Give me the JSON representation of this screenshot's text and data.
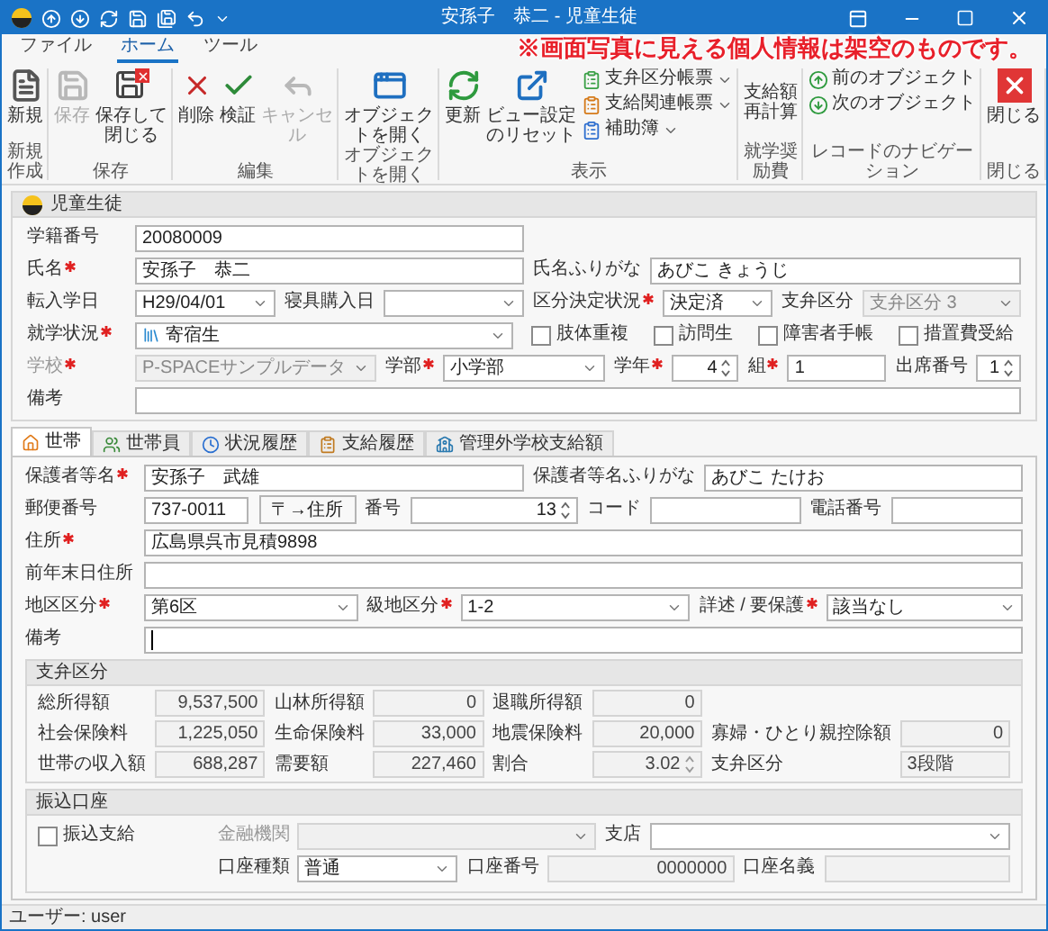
{
  "window": {
    "title": "安孫子　恭二 - 児童生徒"
  },
  "notice": "※画面写真に見える個人情報は架空のものです。",
  "ribbon": {
    "tabs": [
      {
        "label": "ファイル",
        "selected": false
      },
      {
        "label": "ホーム",
        "selected": true
      },
      {
        "label": "ツール",
        "selected": false
      }
    ],
    "groups": [
      {
        "label": "新規作成",
        "items": [
          {
            "kind": "large",
            "label": "新規",
            "disabled": false
          }
        ]
      },
      {
        "label": "保存",
        "items": [
          {
            "kind": "large",
            "label": "保存",
            "disabled": true
          },
          {
            "kind": "large",
            "label": "保存して閉じる",
            "disabled": false
          }
        ]
      },
      {
        "label": "編集",
        "items": [
          {
            "kind": "large",
            "label": "削除",
            "disabled": false
          },
          {
            "kind": "large",
            "label": "検証",
            "disabled": false
          },
          {
            "kind": "large",
            "label": "キャンセル",
            "disabled": true
          }
        ]
      },
      {
        "label": "オブジェクトを開く",
        "items": [
          {
            "kind": "large",
            "label": "オブジェクトを開く",
            "disabled": false
          }
        ]
      },
      {
        "label": "表示",
        "items": [
          {
            "kind": "large",
            "label": "更新",
            "disabled": false
          },
          {
            "kind": "large",
            "label": "ビュー設定のリセット",
            "disabled": false
          },
          {
            "kind": "menu",
            "label": "支弁区分帳票",
            "disabled": false
          },
          {
            "kind": "menu",
            "label": "支給関連帳票",
            "disabled": false
          },
          {
            "kind": "menu",
            "label": "補助簿",
            "disabled": false
          }
        ]
      },
      {
        "label": "就学奨励費",
        "items": [
          {
            "kind": "plain",
            "label": "支給額再計算",
            "disabled": false
          }
        ]
      },
      {
        "label": "レコードのナビゲーション",
        "items": [
          {
            "kind": "small",
            "label": "前のオブジェクト",
            "disabled": false
          },
          {
            "kind": "small",
            "label": "次のオブジェクト",
            "disabled": false
          }
        ]
      },
      {
        "label": "閉じる",
        "items": [
          {
            "kind": "large",
            "label": "閉じる",
            "disabled": false
          }
        ]
      }
    ]
  },
  "student": {
    "title": "児童生徒",
    "rows": [
      [
        {
          "kind": "text",
          "label": "学籍番号",
          "required": false,
          "disabled": false,
          "value": "20080009"
        }
      ],
      [
        {
          "kind": "text",
          "label": "氏名",
          "required": true,
          "disabled": false,
          "value": "安孫子　恭二"
        },
        {
          "kind": "text",
          "label": "氏名ふりがな",
          "required": false,
          "disabled": false,
          "value": "あびこ きょうじ"
        }
      ],
      [
        {
          "kind": "select",
          "label": "転入学日",
          "required": false,
          "disabled": false,
          "value": "H29/04/01"
        },
        {
          "kind": "select",
          "label": "寝具購入日",
          "required": false,
          "disabled": false
        },
        {
          "kind": "select",
          "label": "区分決定状況",
          "required": true,
          "disabled": false,
          "value": "決定済"
        },
        {
          "kind": "select",
          "label": "支弁区分",
          "required": false,
          "disabled": true,
          "value": "支弁区分 3"
        }
      ],
      [
        {
          "kind": "select",
          "label": "就学状況",
          "required": true,
          "disabled": false,
          "value": "寄宿生",
          "has_icon": true
        },
        {
          "kind": "checkbox",
          "label": "肢体重複",
          "checked": false
        },
        {
          "kind": "checkbox",
          "label": "訪問生",
          "checked": false
        },
        {
          "kind": "checkbox",
          "label": "障害者手帳",
          "checked": false
        },
        {
          "kind": "checkbox",
          "label": "措置費受給",
          "checked": false
        }
      ],
      [
        {
          "kind": "select",
          "label": "学校",
          "required": true,
          "disabled": true,
          "value": "P-SPACEサンプルデータ"
        },
        {
          "kind": "select",
          "label": "学部",
          "required": true,
          "disabled": false,
          "value": "小学部"
        },
        {
          "kind": "spin",
          "label": "学年",
          "required": true,
          "disabled": false,
          "value": "4"
        },
        {
          "kind": "text",
          "label": "組",
          "required": true,
          "disabled": false,
          "value": "1"
        },
        {
          "kind": "spin",
          "label": "出席番号",
          "required": false,
          "disabled": false,
          "value": "1"
        }
      ],
      [
        {
          "kind": "text",
          "label": "備考",
          "required": false,
          "disabled": false
        }
      ]
    ]
  },
  "record_tabs": [
    {
      "label": "世帯",
      "selected": true
    },
    {
      "label": "世帯員",
      "selected": false
    },
    {
      "label": "状況履歴",
      "selected": false
    },
    {
      "label": "支給履歴",
      "selected": false
    },
    {
      "label": "管理外学校支給額",
      "selected": false
    }
  ],
  "household": {
    "guardian": [
      {
        "kind": "text",
        "label": "保護者等名",
        "required": true,
        "disabled": false,
        "value": "安孫子　武雄"
      },
      {
        "kind": "text",
        "label": "保護者等名ふりがな",
        "required": false,
        "disabled": false,
        "value": "あびこ たけお"
      }
    ],
    "postal": [
      {
        "kind": "text",
        "label": "郵便番号",
        "required": false,
        "disabled": false,
        "value": "737-0011"
      },
      {
        "kind": "button",
        "value": "〒→住所",
        "disabled": false
      },
      {
        "kind": "spin",
        "label": "番号",
        "required": false,
        "disabled": false,
        "value": "13"
      },
      {
        "kind": "text",
        "label": "コード",
        "required": false,
        "disabled": false
      },
      {
        "kind": "text",
        "label": "電話番号",
        "required": false,
        "disabled": false
      }
    ],
    "address": {
      "kind": "text",
      "label": "住所",
      "required": true,
      "disabled": false,
      "value": "広島県呉市見積9898"
    },
    "previous_address": {
      "kind": "text",
      "label": "前年末日住所",
      "required": false,
      "disabled": false
    },
    "area": [
      {
        "kind": "select",
        "label": "地区区分",
        "required": true,
        "disabled": false,
        "value": "第6区"
      },
      {
        "kind": "select",
        "label": "級地区分",
        "required": true,
        "disabled": false,
        "value": "1-2"
      },
      {
        "kind": "select",
        "label": "詳述 / 要保護",
        "required": true,
        "disabled": false,
        "value": "該当なし"
      }
    ],
    "remarks": {
      "kind": "text",
      "label": "備考",
      "required": false,
      "disabled": false,
      "focused": true
    }
  },
  "support": {
    "title": "支弁区分",
    "rows": [
      [
        {
          "kind": "readonly",
          "label": "総所得額",
          "value": "9,537,500"
        },
        {
          "kind": "readonly",
          "label": "山林所得額",
          "value": "0"
        },
        {
          "kind": "readonly",
          "label": "退職所得額",
          "value": "0"
        }
      ],
      [
        {
          "kind": "readonly",
          "label": "社会保険料",
          "value": "1,225,050"
        },
        {
          "kind": "readonly",
          "label": "生命保険料",
          "value": "33,000"
        },
        {
          "kind": "readonly",
          "label": "地震保険料",
          "value": "20,000"
        },
        {
          "kind": "readonly",
          "label": "寡婦・ひとり親控除額",
          "value": "0"
        }
      ],
      [
        {
          "kind": "readonly",
          "label": "世帯の収入額",
          "value": "688,287"
        },
        {
          "kind": "readonly",
          "label": "需要額",
          "value": "227,460"
        },
        {
          "kind": "readonly_spin",
          "label": "割合",
          "value": "3.02"
        },
        {
          "kind": "readonly_text",
          "label": "支弁区分",
          "value": "3段階"
        }
      ]
    ]
  },
  "transfer": {
    "title": "振込口座",
    "checkbox": {
      "label": "振込支給",
      "checked": false
    },
    "rows": [
      [
        {
          "kind": "select",
          "label": "金融機関",
          "required": false,
          "disabled": true
        },
        {
          "kind": "select",
          "label": "支店",
          "required": false,
          "disabled": false
        }
      ],
      [
        {
          "kind": "select",
          "label": "口座種類",
          "required": false,
          "disabled": false,
          "value": "普通"
        },
        {
          "kind": "readonly",
          "label": "口座番号",
          "value": "0000000"
        },
        {
          "kind": "readonly_text",
          "label": "口座名義"
        }
      ]
    ]
  },
  "status_bar": {
    "user": "ユーザー: user"
  }
}
